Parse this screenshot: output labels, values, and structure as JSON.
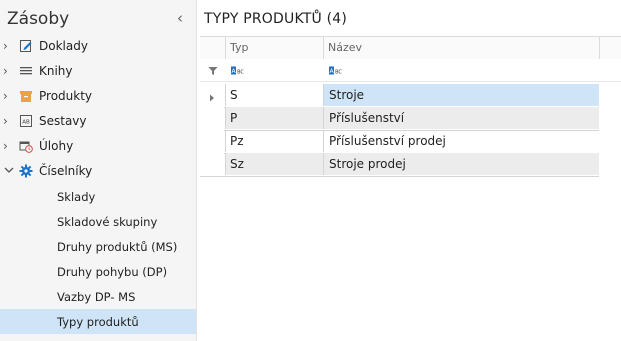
{
  "sidebar": {
    "title": "Zásoby",
    "collapse_icon": "chevron-left-icon",
    "items": [
      {
        "label": "Doklady",
        "icon": "edit-document-icon",
        "expanded": false
      },
      {
        "label": "Knihy",
        "icon": "list-lines-icon",
        "expanded": false
      },
      {
        "label": "Produkty",
        "icon": "box-icon",
        "expanded": false
      },
      {
        "label": "Sestavy",
        "icon": "report-ab-icon",
        "expanded": false
      },
      {
        "label": "Úlohy",
        "icon": "task-clock-icon",
        "expanded": false
      },
      {
        "label": "Číselníky",
        "icon": "gear-icon",
        "expanded": true
      }
    ],
    "subitems": [
      {
        "label": "Sklady"
      },
      {
        "label": "Skladové skupiny"
      },
      {
        "label": "Druhy produktů (MS)"
      },
      {
        "label": "Druhy pohybu (DP)"
      },
      {
        "label": "Vazby DP- MS"
      },
      {
        "label": "Typy produktů",
        "selected": true
      }
    ]
  },
  "main": {
    "title": "TYPY PRODUKTŮ (4)",
    "columns": [
      {
        "label": "Typ"
      },
      {
        "label": "Název"
      }
    ],
    "filter_icon": "filter-icon",
    "filter_type_icon": "text-abc-icon",
    "rows": [
      {
        "typ": "S",
        "nazev": "Stroje",
        "active": true
      },
      {
        "typ": "P",
        "nazev": "Příslušenství"
      },
      {
        "typ": "Pz",
        "nazev": "Příslušenství prodej"
      },
      {
        "typ": "Sz",
        "nazev": "Stroje prodej"
      }
    ]
  },
  "colors": {
    "selection": "#cfe5f7",
    "sidebar_bg": "#f5f5f5",
    "accent_blue": "#1a73c8",
    "accent_orange": "#f0a040"
  }
}
